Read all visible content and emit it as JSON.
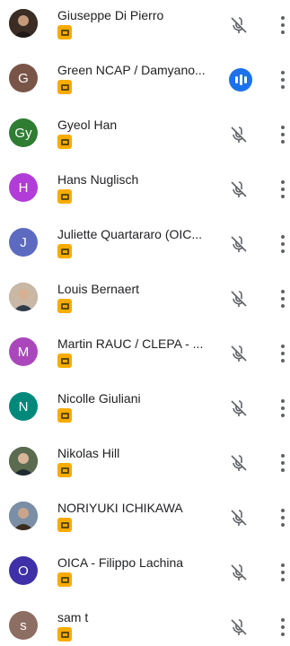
{
  "participants": [
    {
      "name": "Giuseppe Di Pierro",
      "initials": "",
      "color": "#4a3a30",
      "photo": true,
      "muted": true
    },
    {
      "name": "Green NCAP / Damyano...",
      "initials": "G",
      "color": "#795548",
      "photo": false,
      "muted": false,
      "speaking": true
    },
    {
      "name": "Gyeol Han",
      "initials": "Gy",
      "color": "#2e7d32",
      "photo": false,
      "muted": true
    },
    {
      "name": "Hans Nuglisch",
      "initials": "H",
      "color": "#b23cd8",
      "photo": false,
      "muted": true
    },
    {
      "name": "Juliette Quartararo (OIC...",
      "initials": "J",
      "color": "#5c6bc0",
      "photo": false,
      "muted": true
    },
    {
      "name": "Louis Bernaert",
      "initials": "",
      "color": "#8d7b6c",
      "photo": true,
      "muted": true
    },
    {
      "name": "Martin RAUC / CLEPA - ...",
      "initials": "M",
      "color": "#ab47bc",
      "photo": false,
      "muted": true
    },
    {
      "name": "Nicolle Giuliani",
      "initials": "N",
      "color": "#00897b",
      "photo": false,
      "muted": true
    },
    {
      "name": "Nikolas Hill",
      "initials": "",
      "color": "#3e4a3a",
      "photo": true,
      "muted": true
    },
    {
      "name": "NORIYUKI ICHIKAWA",
      "initials": "",
      "color": "#6a7f98",
      "photo": true,
      "muted": true
    },
    {
      "name": "OICA - Filippo Lachina",
      "initials": "O",
      "color": "#3f2fa8",
      "photo": false,
      "muted": true
    },
    {
      "name": "sam t",
      "initials": "s",
      "color": "#8d6e63",
      "photo": false,
      "muted": true
    }
  ],
  "icons": {
    "badge": "presentation-badge-icon",
    "muted": "mic-off-icon",
    "speaking": "audio-level-icon",
    "more": "more-vert-icon"
  },
  "colors": {
    "badge": "#f9ab00",
    "accent": "#1a73e8",
    "icon": "#5f6368"
  }
}
